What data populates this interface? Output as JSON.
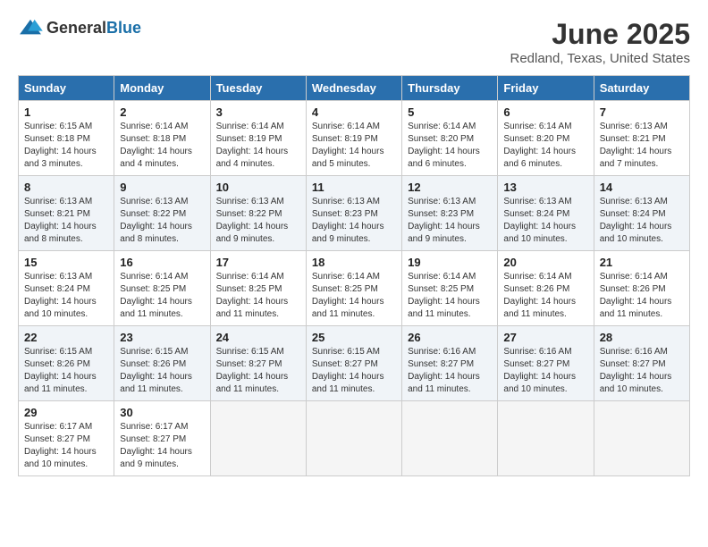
{
  "logo": {
    "text_general": "General",
    "text_blue": "Blue"
  },
  "title": {
    "month": "June 2025",
    "location": "Redland, Texas, United States"
  },
  "headers": [
    "Sunday",
    "Monday",
    "Tuesday",
    "Wednesday",
    "Thursday",
    "Friday",
    "Saturday"
  ],
  "weeks": [
    [
      {
        "day": "1",
        "sunrise": "6:15 AM",
        "sunset": "8:18 PM",
        "daylight": "14 hours and 3 minutes."
      },
      {
        "day": "2",
        "sunrise": "6:14 AM",
        "sunset": "8:18 PM",
        "daylight": "14 hours and 4 minutes."
      },
      {
        "day": "3",
        "sunrise": "6:14 AM",
        "sunset": "8:19 PM",
        "daylight": "14 hours and 4 minutes."
      },
      {
        "day": "4",
        "sunrise": "6:14 AM",
        "sunset": "8:19 PM",
        "daylight": "14 hours and 5 minutes."
      },
      {
        "day": "5",
        "sunrise": "6:14 AM",
        "sunset": "8:20 PM",
        "daylight": "14 hours and 6 minutes."
      },
      {
        "day": "6",
        "sunrise": "6:14 AM",
        "sunset": "8:20 PM",
        "daylight": "14 hours and 6 minutes."
      },
      {
        "day": "7",
        "sunrise": "6:13 AM",
        "sunset": "8:21 PM",
        "daylight": "14 hours and 7 minutes."
      }
    ],
    [
      {
        "day": "8",
        "sunrise": "6:13 AM",
        "sunset": "8:21 PM",
        "daylight": "14 hours and 8 minutes."
      },
      {
        "day": "9",
        "sunrise": "6:13 AM",
        "sunset": "8:22 PM",
        "daylight": "14 hours and 8 minutes."
      },
      {
        "day": "10",
        "sunrise": "6:13 AM",
        "sunset": "8:22 PM",
        "daylight": "14 hours and 9 minutes."
      },
      {
        "day": "11",
        "sunrise": "6:13 AM",
        "sunset": "8:23 PM",
        "daylight": "14 hours and 9 minutes."
      },
      {
        "day": "12",
        "sunrise": "6:13 AM",
        "sunset": "8:23 PM",
        "daylight": "14 hours and 9 minutes."
      },
      {
        "day": "13",
        "sunrise": "6:13 AM",
        "sunset": "8:24 PM",
        "daylight": "14 hours and 10 minutes."
      },
      {
        "day": "14",
        "sunrise": "6:13 AM",
        "sunset": "8:24 PM",
        "daylight": "14 hours and 10 minutes."
      }
    ],
    [
      {
        "day": "15",
        "sunrise": "6:13 AM",
        "sunset": "8:24 PM",
        "daylight": "14 hours and 10 minutes."
      },
      {
        "day": "16",
        "sunrise": "6:14 AM",
        "sunset": "8:25 PM",
        "daylight": "14 hours and 11 minutes."
      },
      {
        "day": "17",
        "sunrise": "6:14 AM",
        "sunset": "8:25 PM",
        "daylight": "14 hours and 11 minutes."
      },
      {
        "day": "18",
        "sunrise": "6:14 AM",
        "sunset": "8:25 PM",
        "daylight": "14 hours and 11 minutes."
      },
      {
        "day": "19",
        "sunrise": "6:14 AM",
        "sunset": "8:25 PM",
        "daylight": "14 hours and 11 minutes."
      },
      {
        "day": "20",
        "sunrise": "6:14 AM",
        "sunset": "8:26 PM",
        "daylight": "14 hours and 11 minutes."
      },
      {
        "day": "21",
        "sunrise": "6:14 AM",
        "sunset": "8:26 PM",
        "daylight": "14 hours and 11 minutes."
      }
    ],
    [
      {
        "day": "22",
        "sunrise": "6:15 AM",
        "sunset": "8:26 PM",
        "daylight": "14 hours and 11 minutes."
      },
      {
        "day": "23",
        "sunrise": "6:15 AM",
        "sunset": "8:26 PM",
        "daylight": "14 hours and 11 minutes."
      },
      {
        "day": "24",
        "sunrise": "6:15 AM",
        "sunset": "8:27 PM",
        "daylight": "14 hours and 11 minutes."
      },
      {
        "day": "25",
        "sunrise": "6:15 AM",
        "sunset": "8:27 PM",
        "daylight": "14 hours and 11 minutes."
      },
      {
        "day": "26",
        "sunrise": "6:16 AM",
        "sunset": "8:27 PM",
        "daylight": "14 hours and 11 minutes."
      },
      {
        "day": "27",
        "sunrise": "6:16 AM",
        "sunset": "8:27 PM",
        "daylight": "14 hours and 10 minutes."
      },
      {
        "day": "28",
        "sunrise": "6:16 AM",
        "sunset": "8:27 PM",
        "daylight": "14 hours and 10 minutes."
      }
    ],
    [
      {
        "day": "29",
        "sunrise": "6:17 AM",
        "sunset": "8:27 PM",
        "daylight": "14 hours and 10 minutes."
      },
      {
        "day": "30",
        "sunrise": "6:17 AM",
        "sunset": "8:27 PM",
        "daylight": "14 hours and 9 minutes."
      },
      null,
      null,
      null,
      null,
      null
    ]
  ],
  "labels": {
    "sunrise": "Sunrise:",
    "sunset": "Sunset:",
    "daylight": "Daylight:"
  }
}
